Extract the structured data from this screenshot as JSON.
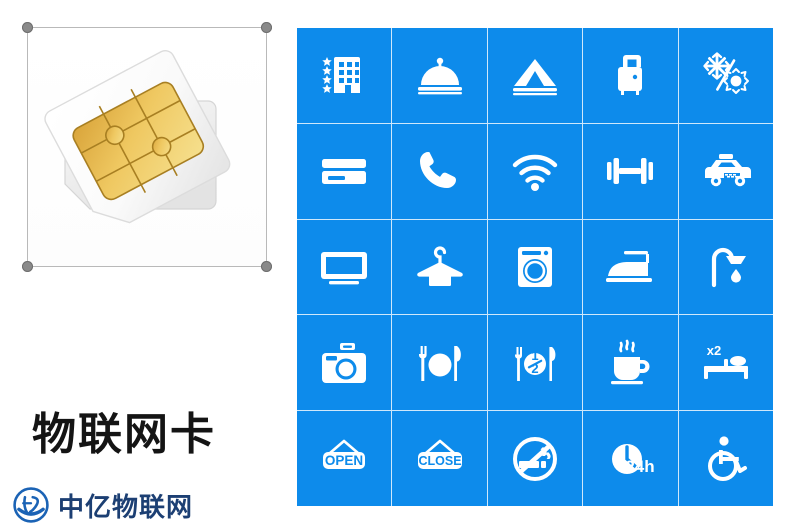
{
  "product": {
    "title": "物联网卡",
    "image_alt": "sim-card-pair",
    "selection_handles": 4
  },
  "brand": {
    "name": "中亿物联网",
    "mark_label": "zy-circular-logo",
    "color": "#1c3f73",
    "mark_color": "#1b63b5"
  },
  "palette": {
    "tile_blue": "#0d8beb",
    "grid_line": "#cfe8fb",
    "glyph_white": "#ffffff",
    "frame_line": "#b9b9b9",
    "handle_gray": "#8a8a8a"
  },
  "icon_grid": {
    "columns": 5,
    "rows": 5,
    "tiles": [
      {
        "name": "hotel-stars-icon",
        "label": "5-star hotel"
      },
      {
        "name": "room-service-icon",
        "label": "Room service"
      },
      {
        "name": "camping-tent-icon",
        "label": "Camping"
      },
      {
        "name": "luggage-icon",
        "label": "Luggage storage"
      },
      {
        "name": "air-conditioning-icon",
        "label": "Heating and cooling"
      },
      {
        "name": "credit-card-icon",
        "label": "Card payment"
      },
      {
        "name": "telephone-icon",
        "label": "Telephone"
      },
      {
        "name": "wifi-icon",
        "label": "Wi-Fi"
      },
      {
        "name": "dumbbell-icon",
        "label": "Fitness"
      },
      {
        "name": "taxi-icon",
        "label": "Taxi service"
      },
      {
        "name": "television-icon",
        "label": "Television"
      },
      {
        "name": "clothes-hanger-icon",
        "label": "Laundry"
      },
      {
        "name": "washing-machine-icon",
        "label": "Washing machine"
      },
      {
        "name": "iron-icon",
        "label": "Ironing"
      },
      {
        "name": "shower-icon",
        "label": "Shower"
      },
      {
        "name": "camera-icon",
        "label": "Photography"
      },
      {
        "name": "restaurant-icon",
        "label": "Restaurant"
      },
      {
        "name": "half-board-icon",
        "label": "Half board",
        "badge": "1/2"
      },
      {
        "name": "coffee-cup-icon",
        "label": "Coffee"
      },
      {
        "name": "double-bed-icon",
        "label": "Double occupancy",
        "badge": "x2"
      },
      {
        "name": "open-sign-icon",
        "label": "Open",
        "badge": "OPEN"
      },
      {
        "name": "close-sign-icon",
        "label": "Close",
        "badge": "CLOSE"
      },
      {
        "name": "no-smoking-icon",
        "label": "No smoking"
      },
      {
        "name": "24h-clock-icon",
        "label": "24 hour service",
        "badge": "24h"
      },
      {
        "name": "wheelchair-icon",
        "label": "Accessible"
      }
    ]
  }
}
